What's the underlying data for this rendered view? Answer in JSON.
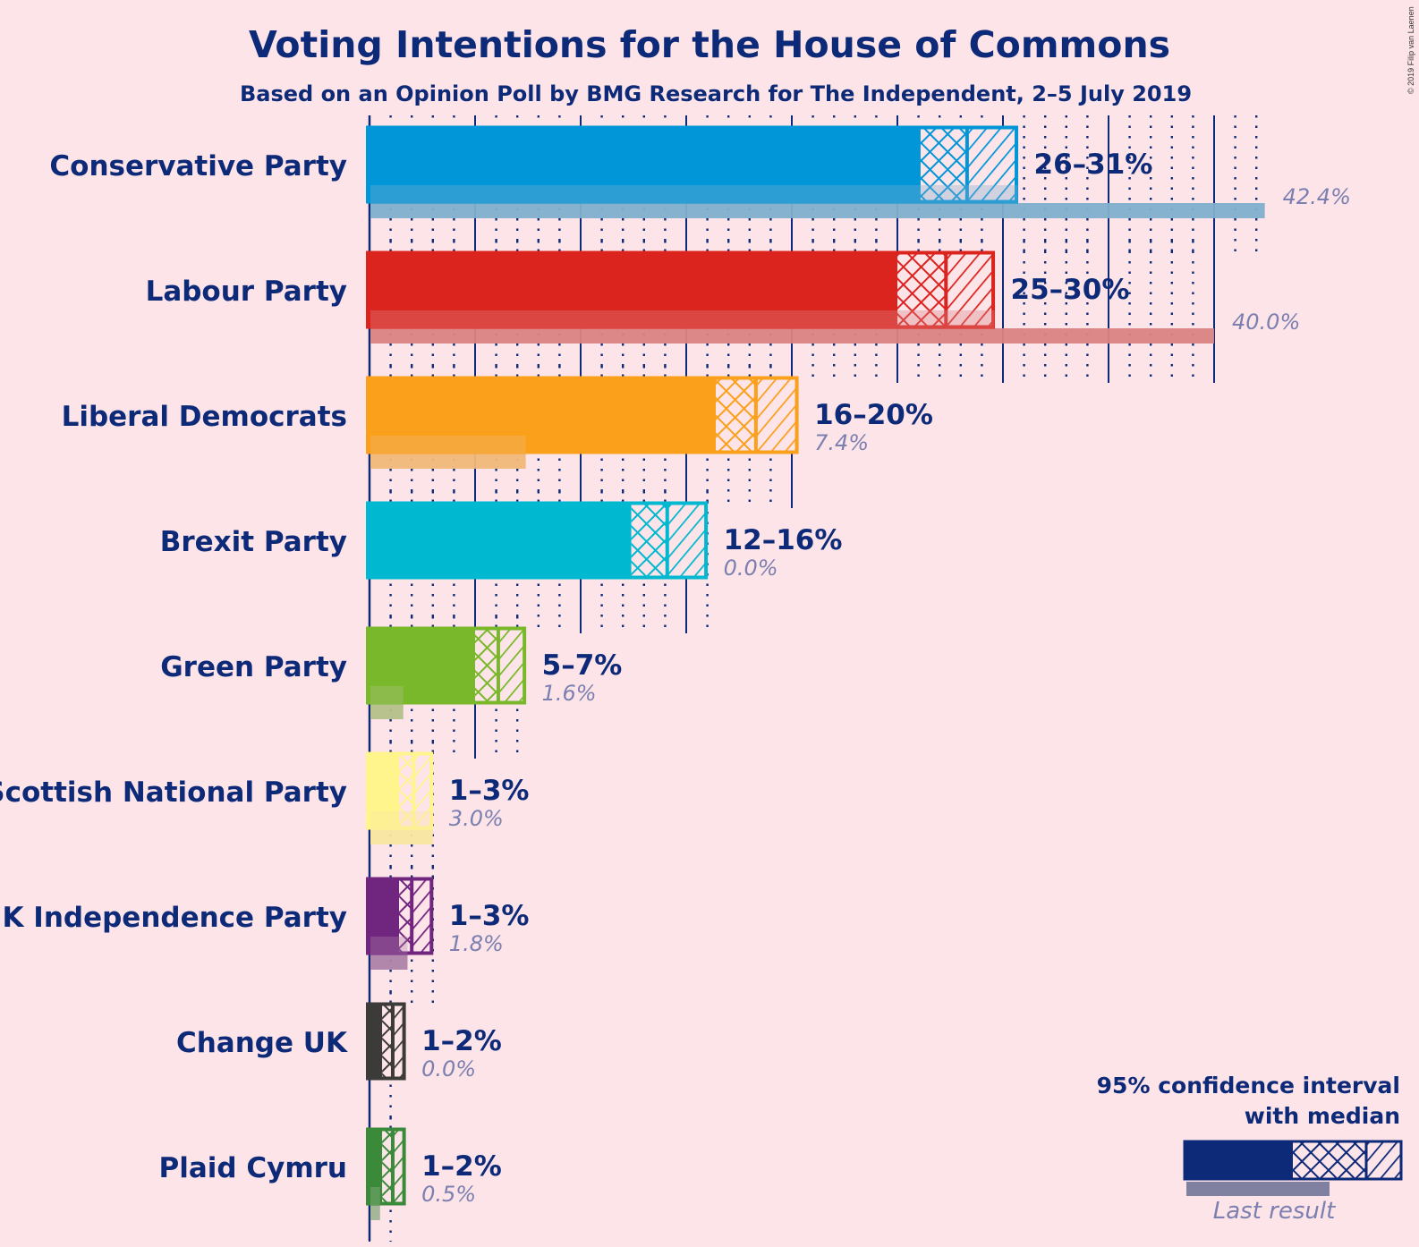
{
  "chart_data": {
    "type": "bar",
    "title": "Voting Intentions for the House of Commons",
    "subtitle": "Based on an Opinion Poll by BMG Research for The Independent, 2–5 July 2019",
    "copyright": "© 2019 Filip van Laenen",
    "xlabel": "",
    "ylabel": "",
    "x_unit": "%",
    "xlim": [
      0,
      45
    ],
    "grid": true,
    "grid_major_step": 5,
    "grid_minor_step": 1,
    "legend": {
      "position": "bottom-right",
      "title_line1": "95% confidence interval",
      "title_line2": "with median",
      "last_result_label": "Last result",
      "color": "#0d2a78",
      "last_color": "#8080a0"
    },
    "categories": [
      "Conservative Party",
      "Labour Party",
      "Liberal Democrats",
      "Brexit Party",
      "Green Party",
      "Scottish National Party",
      "UK Independence Party",
      "Change UK",
      "Plaid Cymru"
    ],
    "series": [
      {
        "name": "Conservative Party",
        "color": "#0096d8",
        "last_color": "#7fafcf",
        "ci_low": 26.1,
        "median": 28.3,
        "ci_high": 30.7,
        "range_label": "26–31%",
        "last_result": 42.4,
        "last_label": "42.4%"
      },
      {
        "name": "Labour Party",
        "color": "#dc241f",
        "last_color": "#da8383",
        "ci_low": 25.0,
        "median": 27.3,
        "ci_high": 29.6,
        "range_label": "25–30%",
        "last_result": 40.0,
        "last_label": "40.0%"
      },
      {
        "name": "Liberal Democrats",
        "color": "#faa01a",
        "last_color": "#f0b87a",
        "ci_low": 16.4,
        "median": 18.3,
        "ci_high": 20.3,
        "range_label": "16–20%",
        "last_result": 7.4,
        "last_label": "7.4%"
      },
      {
        "name": "Brexit Party",
        "color": "#00b8cf",
        "last_color": "#7fc8d6",
        "ci_low": 12.4,
        "median": 14.1,
        "ci_high": 16.0,
        "range_label": "12–16%",
        "last_result": 0.0,
        "last_label": "0.0%"
      },
      {
        "name": "Green Party",
        "color": "#78b82a",
        "last_color": "#b3c08a",
        "ci_low": 5.0,
        "median": 6.1,
        "ci_high": 7.4,
        "range_label": "5–7%",
        "last_result": 1.6,
        "last_label": "1.6%"
      },
      {
        "name": "Scottish National Party",
        "color": "#fff58c",
        "last_color": "#f8e6a0",
        "ci_low": 1.4,
        "median": 2.1,
        "ci_high": 3.0,
        "range_label": "1–3%",
        "last_result": 3.0,
        "last_label": "3.0%"
      },
      {
        "name": "UK Independence Party",
        "color": "#70257f",
        "last_color": "#ad83a8",
        "ci_low": 1.4,
        "median": 2.0,
        "ci_high": 3.0,
        "range_label": "1–3%",
        "last_result": 1.8,
        "last_label": "1.8%"
      },
      {
        "name": "Change UK",
        "color": "#3c3b3a",
        "last_color": "#9a9494",
        "ci_low": 0.6,
        "median": 1.1,
        "ci_high": 1.7,
        "range_label": "1–2%",
        "last_result": 0.0,
        "last_label": "0.0%"
      },
      {
        "name": "Plaid Cymru",
        "color": "#3a8a3a",
        "last_color": "#a0b494",
        "ci_low": 0.6,
        "median": 1.1,
        "ci_high": 1.7,
        "range_label": "1–2%",
        "last_result": 0.5,
        "last_label": "0.5%"
      }
    ]
  }
}
